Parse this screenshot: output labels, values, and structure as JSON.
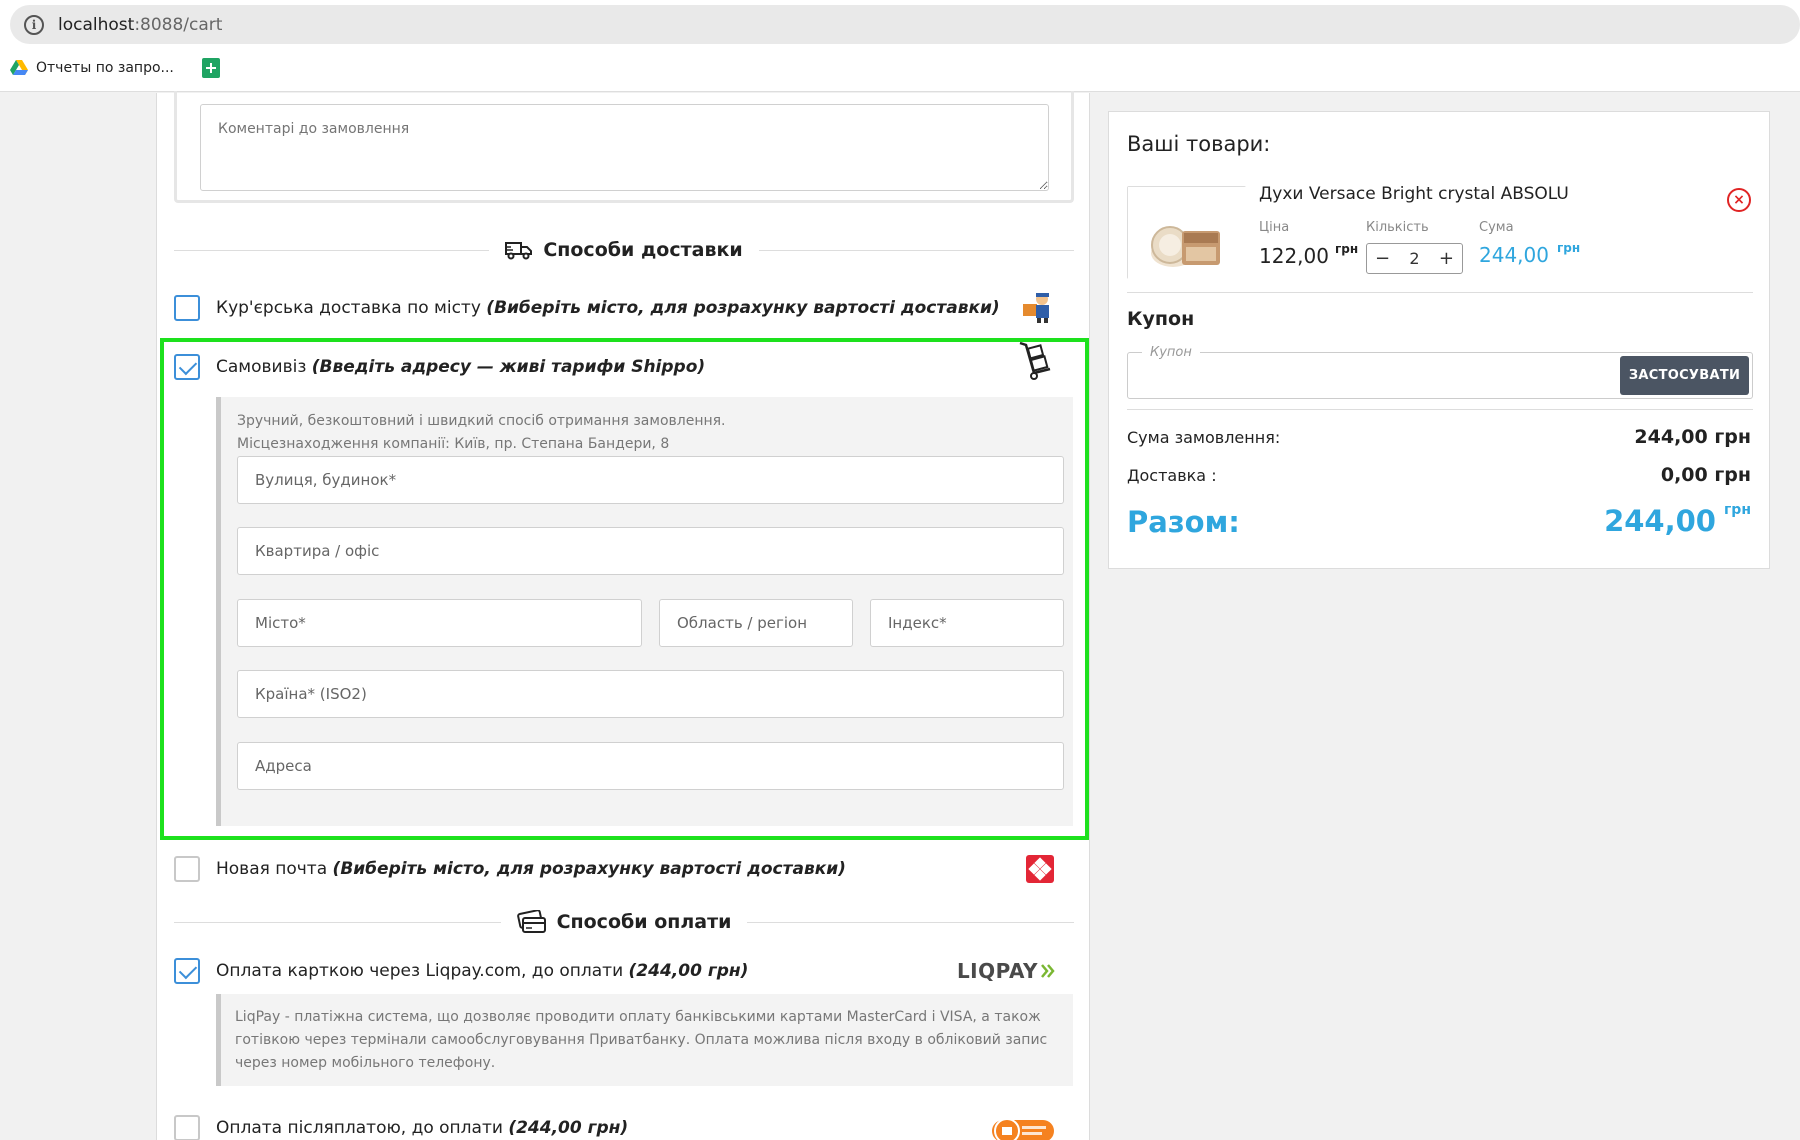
{
  "browser": {
    "url_host": "localhost",
    "url_rest": ":8088/cart",
    "bookmark_label": "Отчеты по запро..."
  },
  "comment": {
    "placeholder": "Коментарі до замовлення"
  },
  "delivery": {
    "title": "Способи доставки",
    "options": [
      {
        "label": "Кур'єрська доставка по місту",
        "note": "(Виберіть місто, для розрахунку вартості доставки)",
        "checked": false
      },
      {
        "label": "Самовивіз",
        "note": "(Введіть адресу — живі тарифи Shippo)",
        "checked": true
      },
      {
        "label": "Новая почта",
        "note": "(Виберіть місто, для розрахунку вартості доставки)",
        "checked": false
      }
    ],
    "pickup": {
      "desc_line1": "Зручний, безкоштовний і швидкий спосіб отримання замовлення.",
      "desc_line2": "Місцезнаходження компанії: Київ, пр. Степана Бандери, 8",
      "street": "Вулиця, будинок*",
      "apartment": "Квартира / офіс",
      "city": "Місто*",
      "region": "Область / регіон",
      "zip": "Індекс*",
      "country": "Країна* (ISO2)",
      "address": "Адреса"
    }
  },
  "payment": {
    "title": "Способи оплати",
    "options": [
      {
        "label": "Оплата карткою через Liqpay.com, до оплати",
        "note": "(244,00 грн)",
        "checked": true,
        "logo": "LIQPAY"
      },
      {
        "label": "Оплата післяплатою, до оплати",
        "note": "(244,00 грн)",
        "checked": false
      }
    ],
    "liqpay_desc": "LiqPay - платіжна система, що дозволяє проводити оплату банківськими картами MasterCard і VISA, а також готівкою через термінали самообслуговування Приватбанку. Оплата можлива після входу в обліковий запис через номер мобільного телефону."
  },
  "cart": {
    "title": "Ваші товари:",
    "item": {
      "name": "Духи Versace Bright crystal ABSOLU",
      "price_label": "Ціна",
      "qty_label": "Кількість",
      "sum_label": "Сума",
      "price": "122,00",
      "qty": "2",
      "sum": "244,00",
      "currency": "грн"
    },
    "coupon_title": "Купон",
    "coupon_legend": "Купон",
    "apply_label": "ЗАСТОСУВАТИ",
    "order_sum_label": "Сума замовлення:",
    "order_sum": "244,00 грн",
    "delivery_label": "Доставка :",
    "delivery_sum": "0,00 грн",
    "total_label": "Разом:",
    "total": "244,00",
    "currency": "грн"
  },
  "colors": {
    "accent": "#2fa6de",
    "highlight": "#1de11d",
    "checkbox": "#3c8fd9",
    "danger": "#e02424"
  }
}
